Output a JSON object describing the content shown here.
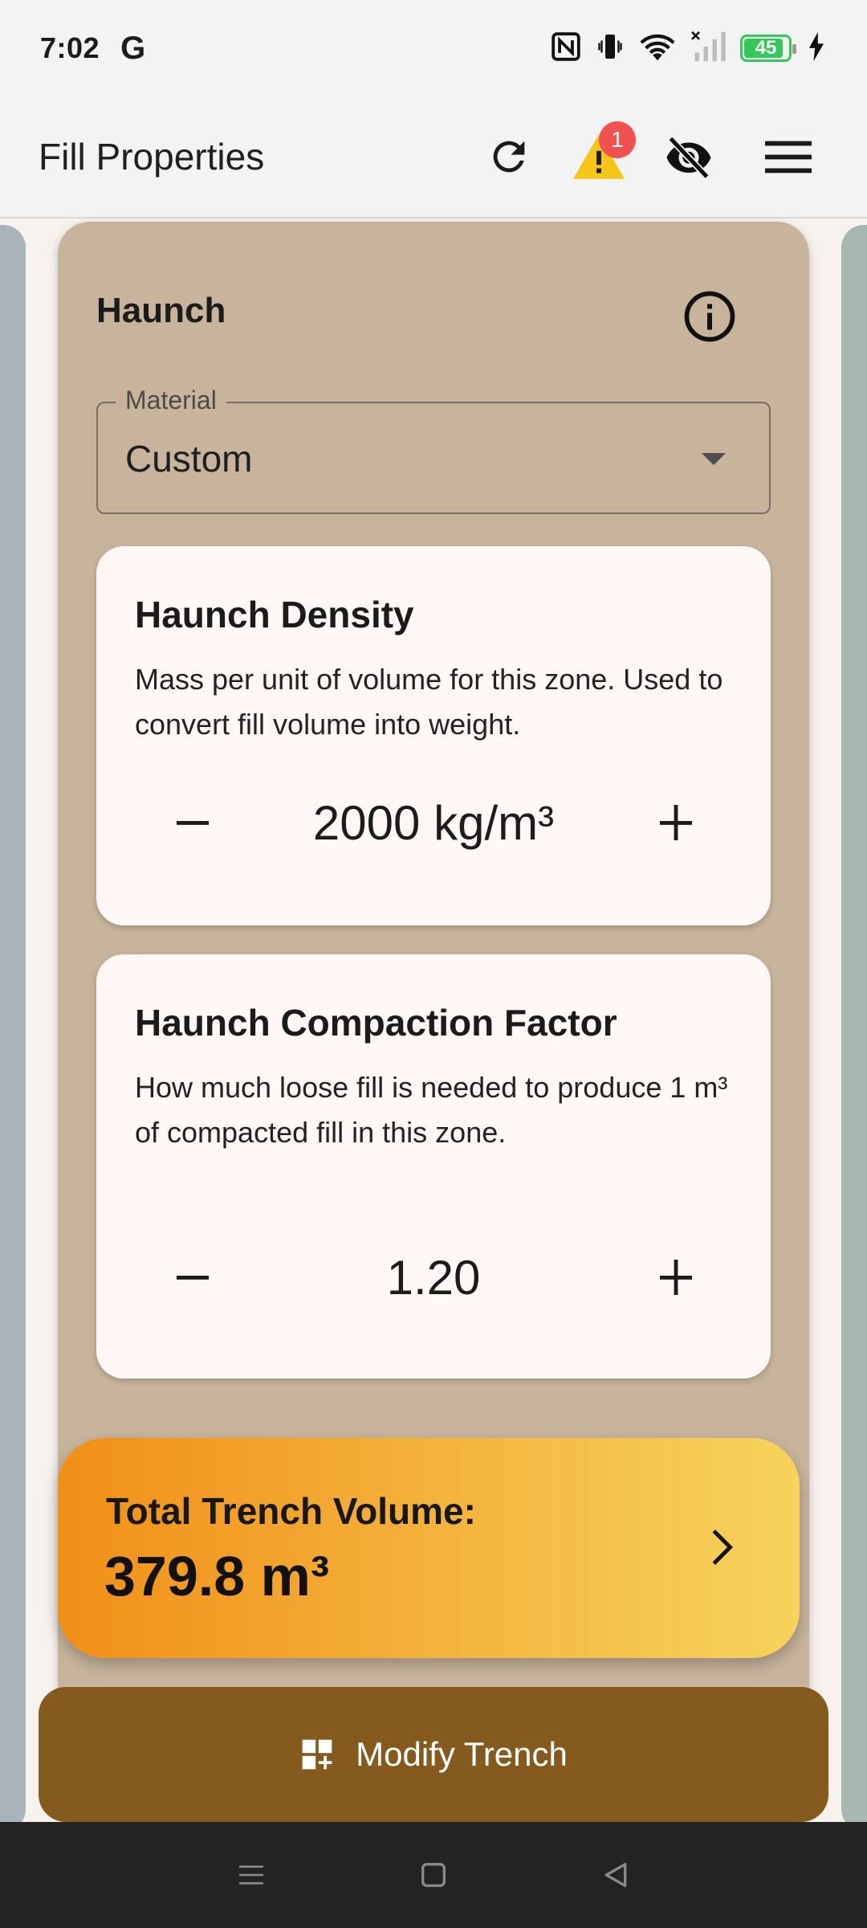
{
  "status_bar": {
    "time": "7:02",
    "carrier_glyph": "G",
    "battery_level": "45",
    "battery_fraction": 0.45,
    "icons": [
      "nfc-icon",
      "vibrate-icon",
      "wifi-icon",
      "signal-icon",
      "battery-icon",
      "charging-icon"
    ]
  },
  "app_bar": {
    "title": "Fill Properties",
    "warning_badge_count": "1",
    "icons": [
      "refresh-icon",
      "warning-icon",
      "visibility-off-icon",
      "menu-icon"
    ]
  },
  "section": {
    "title": "Haunch",
    "material_label": "Material",
    "material_value": "Custom"
  },
  "density_card": {
    "title": "Haunch Density",
    "description": "Mass per unit of volume for this zone. Used to convert fill volume into weight.",
    "value": "2000 kg/m³"
  },
  "compaction_card": {
    "title": "Haunch Compaction Factor",
    "description": "How much loose fill is needed to produce 1 m³ of compacted fill in this zone.",
    "value": "1.20"
  },
  "total": {
    "label": "Total Trench Volume:",
    "value": "379.8 m³"
  },
  "modify_button": {
    "label": "Modify Trench"
  },
  "colors": {
    "panel": "#c8b49c",
    "accent_orange": "#f18f17",
    "accent_yellow": "#f7d35c",
    "button_brown": "#845a1e",
    "badge_red": "#f05252",
    "warning_yellow": "#f5c518"
  }
}
